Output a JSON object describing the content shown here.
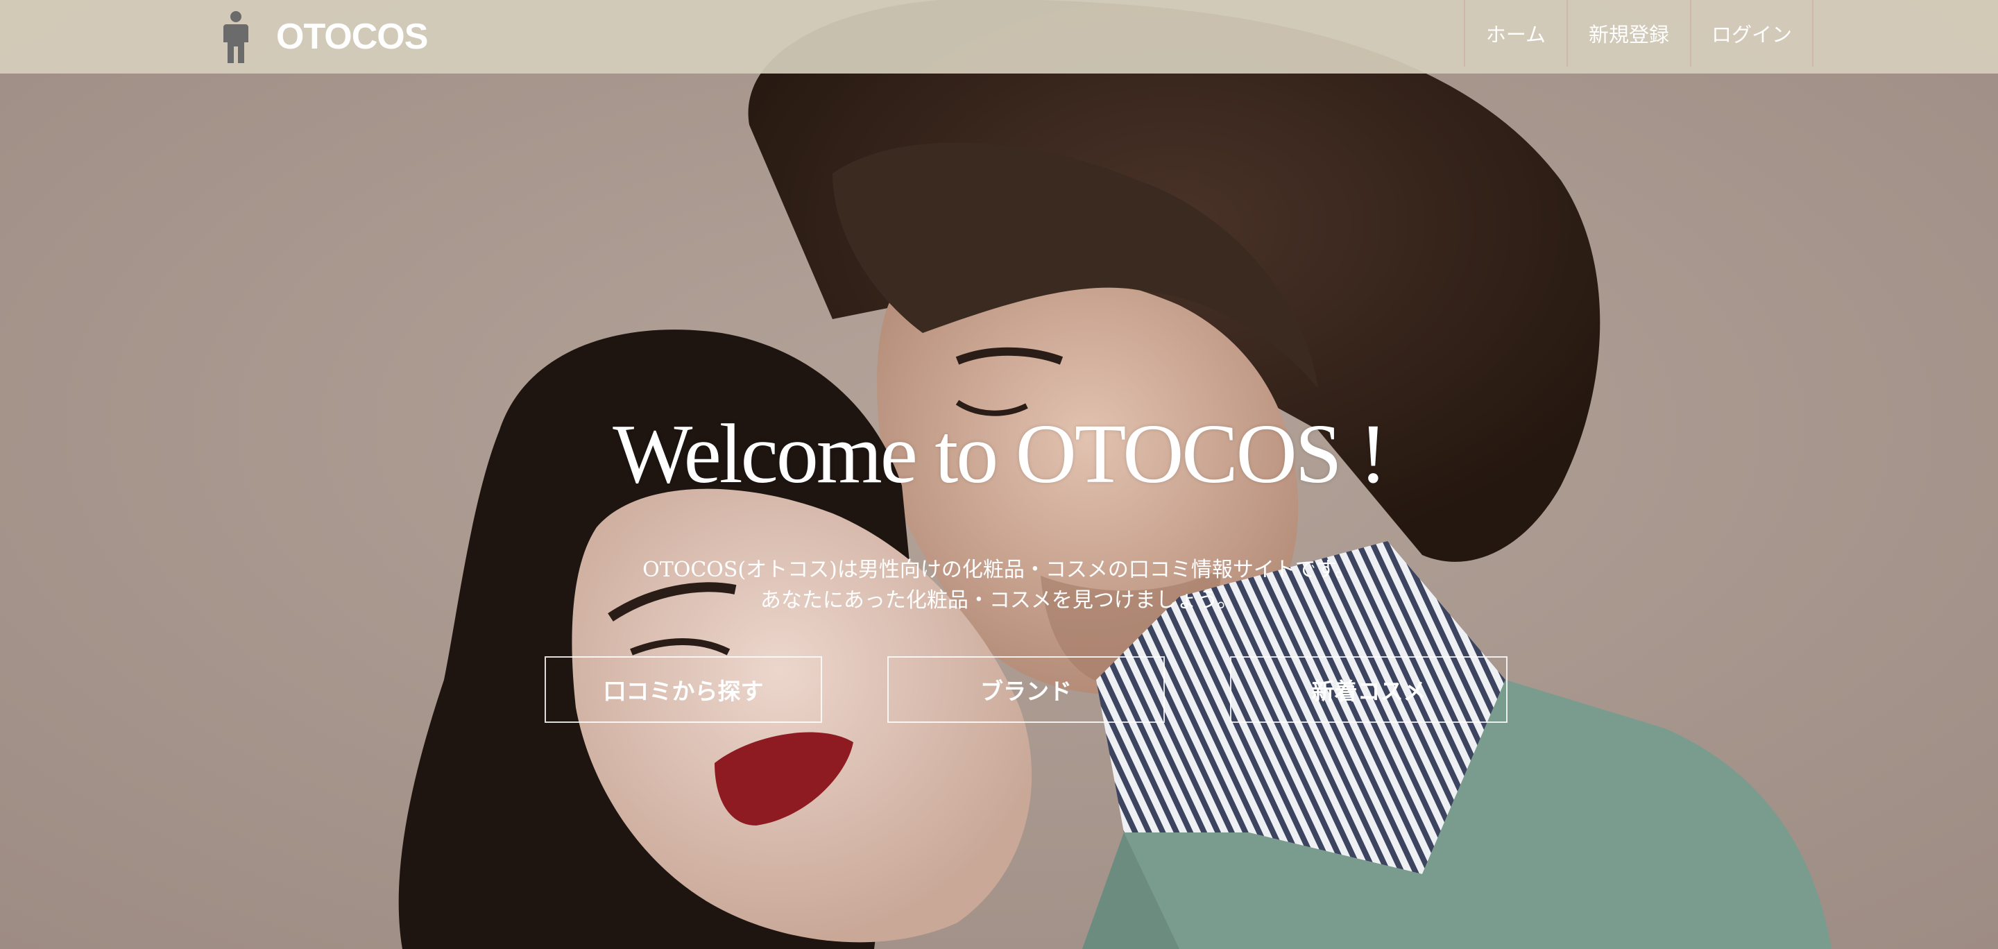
{
  "brand": {
    "name": "OTOCOS",
    "icon": "person-icon"
  },
  "nav": {
    "home": "ホーム",
    "signup": "新規登録",
    "login": "ログイン"
  },
  "hero": {
    "title": "Welcome to OTOCOS !",
    "description_line1": "OTOCOS(オトコス)は男性向けの化粧品・コスメの口コミ情報サイトです。",
    "description_line2": "あなたにあった化粧品・コスメを見つけましょう。",
    "buttons": {
      "reviews": "口コミから探す",
      "brands": "ブランド",
      "new_cosme": "新着コスメ"
    }
  },
  "colors": {
    "navbar_bg": "#d6cebc",
    "hero_bg": "#a89890",
    "text": "#ffffff"
  }
}
